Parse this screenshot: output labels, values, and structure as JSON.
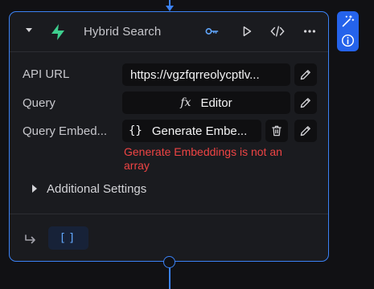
{
  "node": {
    "title": "Hybrid Search",
    "accent_color": "#3b82f6",
    "logo_color": "#3ecf8e",
    "header_icons": [
      "chevron-down-icon",
      "supabase-logo",
      "key-icon",
      "play-icon",
      "code-icon",
      "more-icon"
    ]
  },
  "fields": {
    "api_url": {
      "label": "API URL",
      "value": "https://vgzfqrreolycptlv..."
    },
    "query": {
      "label": "Query",
      "value": "Editor",
      "icon": "function-icon"
    },
    "query_embedding": {
      "label": "Query Embed...",
      "value": "Generate Embe...",
      "icon": "braces-icon"
    }
  },
  "error": {
    "message": "Generate Embeddings is not an array",
    "color": "#ef4444"
  },
  "settings": {
    "label": "Additional Settings"
  },
  "output": {
    "badge": "[]"
  },
  "side_tools": [
    "magic-wand-icon",
    "info-icon"
  ]
}
